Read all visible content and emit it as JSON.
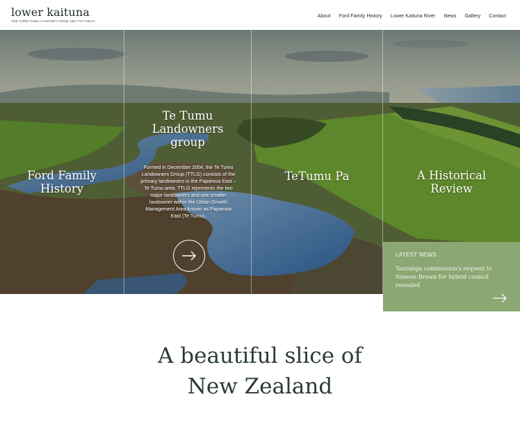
{
  "site": {
    "logo_title": "lower kaituna",
    "logo_tagline": "THE FORD FAMILY HISTORY FROM 1907 TO TODAY"
  },
  "nav": {
    "items": [
      {
        "label": "About"
      },
      {
        "label": "Ford Family History"
      },
      {
        "label": "Lower Kaituna River"
      },
      {
        "label": "News"
      },
      {
        "label": "Gallery"
      },
      {
        "label": "Contact"
      }
    ]
  },
  "hero": {
    "panels": [
      {
        "title": "Ford Family\nHistory"
      },
      {
        "title": "Te Tumu\nLandowners\ngroup",
        "description": "Formed in December 2004, the Te Tumu Landowners Group (TTLG) consists of the primary landowners in the Papamoa East – Te Tumu area. TTLG represents the two major landowners and one smaller landowner within the Urban Growth Management Area known as Papamoa East (Te Tumu).",
        "cta_icon": "arrow-right-icon"
      },
      {
        "title": "TeTumu Pa"
      },
      {
        "title": "A Historical\nReview"
      }
    ]
  },
  "news": {
    "label": "LATEST NEWS",
    "headline": "Tauranga commission's request to Simeon Brown for hybrid council revealed",
    "arrow_icon": "arrow-right-icon",
    "bg_color": "#8ba772"
  },
  "tagline": {
    "line1": "A beautiful slice of",
    "line2": "New Zealand"
  },
  "colors": {
    "text_dark": "#2b3b36",
    "news_green": "#8ba772"
  }
}
